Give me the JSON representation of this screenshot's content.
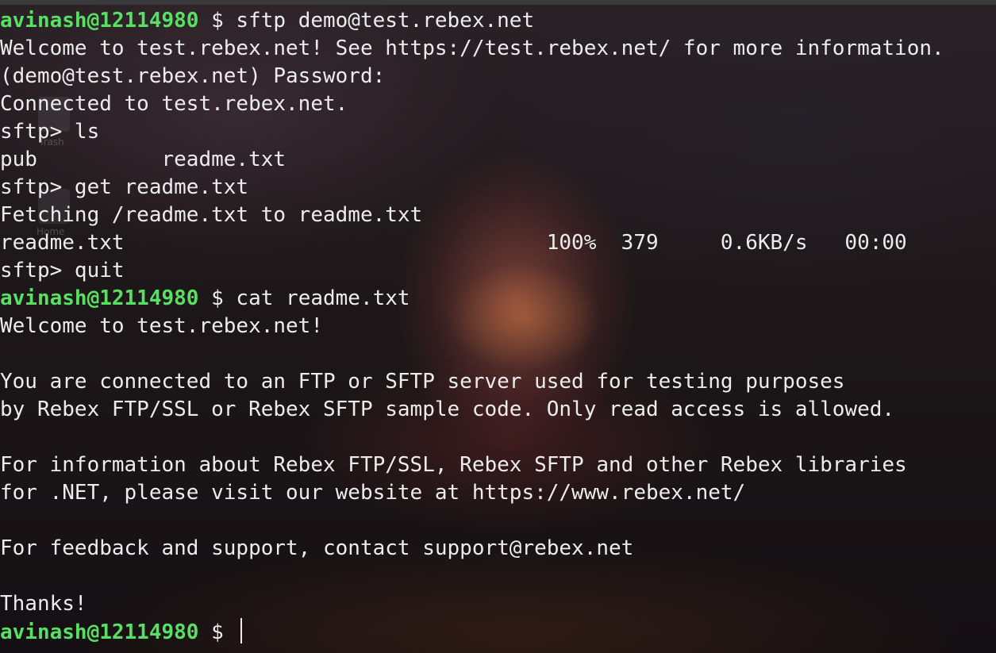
{
  "desktop": {
    "icons": [
      {
        "label": "Trash",
        "icon": "trash-icon"
      },
      {
        "label": "Home",
        "icon": "home-folder-icon"
      }
    ]
  },
  "terminal": {
    "prompt": {
      "user_host": "avinash@12114980",
      "symbol": " $ "
    },
    "lines": [
      {
        "type": "prompt",
        "command": "sftp demo@test.rebex.net"
      },
      {
        "type": "output",
        "text": "Welcome to test.rebex.net! See https://test.rebex.net/ for more information."
      },
      {
        "type": "output",
        "text": "(demo@test.rebex.net) Password:"
      },
      {
        "type": "output",
        "text": "Connected to test.rebex.net."
      },
      {
        "type": "output",
        "text": "sftp> ls"
      },
      {
        "type": "output",
        "text": "pub          readme.txt"
      },
      {
        "type": "output",
        "text": "sftp> get readme.txt"
      },
      {
        "type": "output",
        "text": "Fetching /readme.txt to readme.txt"
      },
      {
        "type": "output",
        "text": "readme.txt                                  100%  379     0.6KB/s   00:00"
      },
      {
        "type": "output",
        "text": "sftp> quit"
      },
      {
        "type": "prompt",
        "command": "cat readme.txt"
      },
      {
        "type": "output",
        "text": "Welcome to test.rebex.net!"
      },
      {
        "type": "output",
        "text": ""
      },
      {
        "type": "output",
        "text": "You are connected to an FTP or SFTP server used for testing purposes"
      },
      {
        "type": "output",
        "text": "by Rebex FTP/SSL or Rebex SFTP sample code. Only read access is allowed."
      },
      {
        "type": "output",
        "text": ""
      },
      {
        "type": "output",
        "text": "For information about Rebex FTP/SSL, Rebex SFTP and other Rebex libraries"
      },
      {
        "type": "output",
        "text": "for .NET, please visit our website at https://www.rebex.net/"
      },
      {
        "type": "output",
        "text": ""
      },
      {
        "type": "output",
        "text": "For feedback and support, contact support@rebex.net"
      },
      {
        "type": "output",
        "text": ""
      },
      {
        "type": "output",
        "text": "Thanks!"
      },
      {
        "type": "prompt",
        "command": "",
        "cursor": true
      }
    ]
  },
  "colors": {
    "prompt_user": "#58e063",
    "text": "#ececec"
  }
}
